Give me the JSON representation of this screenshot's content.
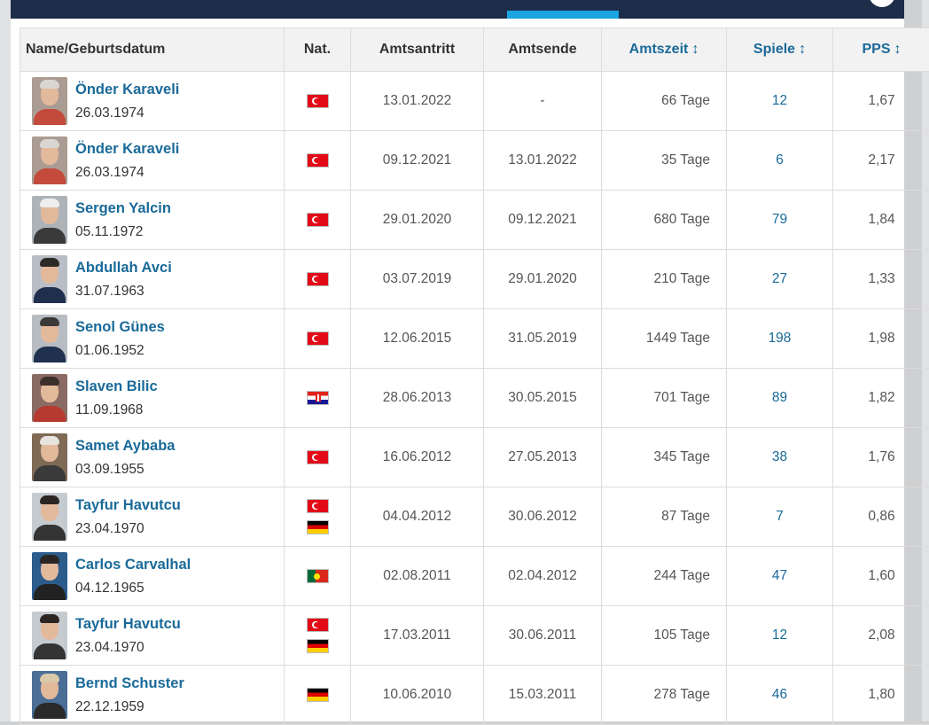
{
  "table": {
    "headers": {
      "name": "Name/Geburtsdatum",
      "nat": "Nat.",
      "start": "Amtsantritt",
      "end": "Amtsende",
      "tenure": "Amtszeit",
      "matches": "Spiele",
      "pps": "PPS",
      "sort_icon": "↕"
    },
    "rows": [
      {
        "name": "Önder Karaveli",
        "dob": "26.03.1974",
        "flags": [
          "tr"
        ],
        "start": "13.01.2022",
        "end": "-",
        "tenure": "66 Tage",
        "matches": "12",
        "pps": "1,67"
      },
      {
        "name": "Önder Karaveli",
        "dob": "26.03.1974",
        "flags": [
          "tr"
        ],
        "start": "09.12.2021",
        "end": "13.01.2022",
        "tenure": "35 Tage",
        "matches": "6",
        "pps": "2,17"
      },
      {
        "name": "Sergen Yalcin",
        "dob": "05.11.1972",
        "flags": [
          "tr"
        ],
        "start": "29.01.2020",
        "end": "09.12.2021",
        "tenure": "680 Tage",
        "matches": "79",
        "pps": "1,84"
      },
      {
        "name": "Abdullah Avci",
        "dob": "31.07.1963",
        "flags": [
          "tr"
        ],
        "start": "03.07.2019",
        "end": "29.01.2020",
        "tenure": "210 Tage",
        "matches": "27",
        "pps": "1,33"
      },
      {
        "name": "Senol Günes",
        "dob": "01.06.1952",
        "flags": [
          "tr"
        ],
        "start": "12.06.2015",
        "end": "31.05.2019",
        "tenure": "1449 Tage",
        "matches": "198",
        "pps": "1,98"
      },
      {
        "name": "Slaven Bilic",
        "dob": "11.09.1968",
        "flags": [
          "hr"
        ],
        "start": "28.06.2013",
        "end": "30.05.2015",
        "tenure": "701 Tage",
        "matches": "89",
        "pps": "1,82"
      },
      {
        "name": "Samet Aybaba",
        "dob": "03.09.1955",
        "flags": [
          "tr"
        ],
        "start": "16.06.2012",
        "end": "27.05.2013",
        "tenure": "345 Tage",
        "matches": "38",
        "pps": "1,76"
      },
      {
        "name": "Tayfur Havutcu",
        "dob": "23.04.1970",
        "flags": [
          "tr",
          "de"
        ],
        "start": "04.04.2012",
        "end": "30.06.2012",
        "tenure": "87 Tage",
        "matches": "7",
        "pps": "0,86"
      },
      {
        "name": "Carlos Carvalhal",
        "dob": "04.12.1965",
        "flags": [
          "pt"
        ],
        "start": "02.08.2011",
        "end": "02.04.2012",
        "tenure": "244 Tage",
        "matches": "47",
        "pps": "1,60"
      },
      {
        "name": "Tayfur Havutcu",
        "dob": "23.04.1970",
        "flags": [
          "tr",
          "de"
        ],
        "start": "17.03.2011",
        "end": "30.06.2011",
        "tenure": "105 Tage",
        "matches": "12",
        "pps": "2,08"
      },
      {
        "name": "Bernd Schuster",
        "dob": "22.12.1959",
        "flags": [
          "de"
        ],
        "start": "10.06.2010",
        "end": "15.03.2011",
        "tenure": "278 Tage",
        "matches": "46",
        "pps": "1,80"
      }
    ]
  },
  "colors": {
    "link": "#1a6a99",
    "topbar": "#1c2d4a",
    "tab_indicator": "#1aa5e0",
    "header_bg": "#f2f2f2"
  }
}
